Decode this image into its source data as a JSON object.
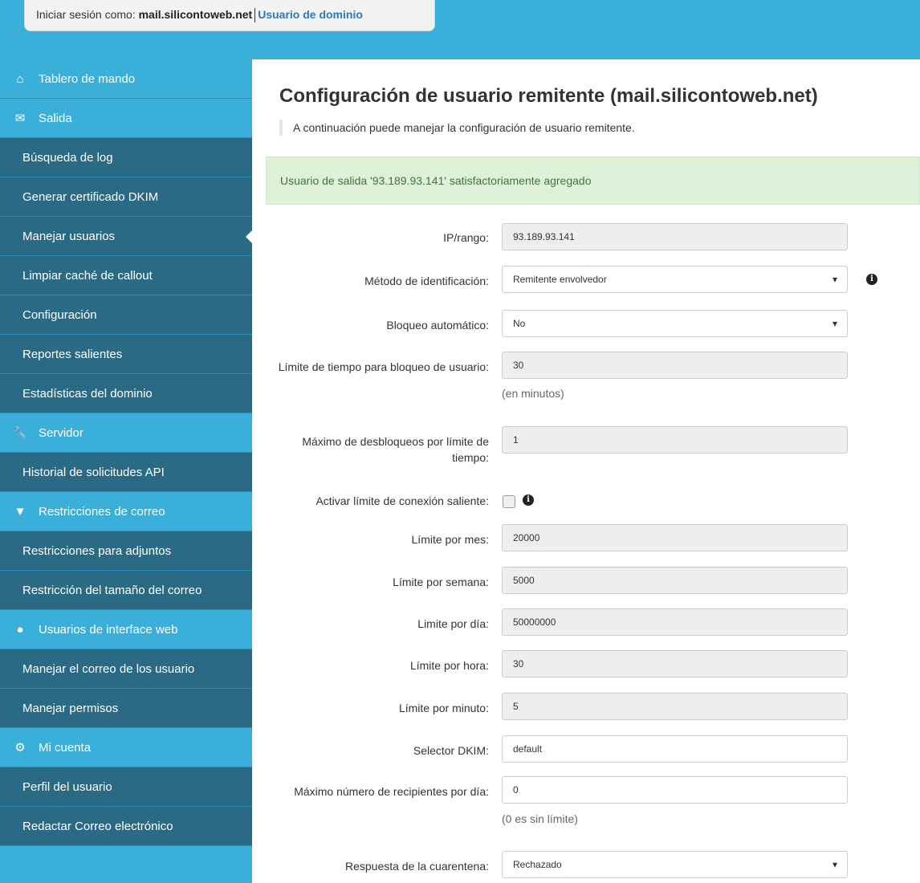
{
  "header": {
    "login_prefix": "Iniciar sesión como:",
    "host": "mail.silicontoweb.net",
    "role": "Usuario de dominio"
  },
  "sidebar": {
    "items": [
      {
        "label": "Tablero de mando",
        "type": "header",
        "icon": "home-icon"
      },
      {
        "label": "Salida",
        "type": "header",
        "icon": "envelope-icon"
      },
      {
        "label": "Búsqueda de log",
        "type": "sub"
      },
      {
        "label": "Generar certificado DKIM",
        "type": "sub"
      },
      {
        "label": "Manejar usuarios",
        "type": "sub",
        "active": true
      },
      {
        "label": "Limpiar caché de callout",
        "type": "sub"
      },
      {
        "label": "Configuración",
        "type": "sub"
      },
      {
        "label": "Reportes salientes",
        "type": "sub"
      },
      {
        "label": "Estadísticas del dominio",
        "type": "sub"
      },
      {
        "label": "Servidor",
        "type": "header",
        "icon": "wrench-icon"
      },
      {
        "label": "Historial de solicitudes API",
        "type": "sub"
      },
      {
        "label": "Restricciones de correo",
        "type": "header",
        "icon": "filter-icon"
      },
      {
        "label": "Restricciones para adjuntos",
        "type": "sub"
      },
      {
        "label": "Restricción del tamaño del correo",
        "type": "sub"
      },
      {
        "label": "Usuarios de interface web",
        "type": "header",
        "icon": "user-icon"
      },
      {
        "label": "Manejar el correo de los usuario",
        "type": "sub"
      },
      {
        "label": "Manejar permisos",
        "type": "sub"
      },
      {
        "label": "Mi cuenta",
        "type": "header",
        "icon": "gear-icon"
      },
      {
        "label": "Perfil del usuario",
        "type": "sub"
      },
      {
        "label": "Redactar Correo electrónico",
        "type": "sub"
      }
    ]
  },
  "main": {
    "title": "Configuración de usuario remitente (mail.silicontoweb.net)",
    "description": "A continuación puede manejar la configuración de usuario remitente.",
    "alert": "Usuario de salida '93.189.93.141' satisfactoriamente agregado"
  },
  "form": {
    "ip_label": "IP/rango:",
    "ip_value": "93.189.93.141",
    "method_label": "Método de identificación:",
    "method_value": "Remitente envolvedor",
    "autoblock_label": "Bloqueo automático:",
    "autoblock_value": "No",
    "blocktime_label": "Límite de tiempo para bloqueo de usuario:",
    "blocktime_value": "30",
    "blocktime_help": "(en minutos)",
    "maxunblock_label": "Máximo de desbloqueos por límite de tiempo:",
    "maxunblock_value": "1",
    "connlimit_label": "Activar límite de conexión saliente:",
    "month_label": "Límite por mes:",
    "month_value": "20000",
    "week_label": "Límite por semana:",
    "week_value": "5000",
    "day_label": "Limite por día:",
    "day_value": "50000000",
    "hour_label": "Límite por hora:",
    "hour_value": "30",
    "minute_label": "Límite por minuto:",
    "minute_value": "5",
    "dkim_label": "Selector DKIM:",
    "dkim_value": "default",
    "maxrcpt_label": "Máximo número de recipientes por día:",
    "maxrcpt_value": "0",
    "maxrcpt_help": "(0 es sin límite)",
    "quarantine_label": "Respuesta de la cuarentena:",
    "quarantine_value": "Rechazado"
  },
  "icons": {
    "info": "i"
  }
}
